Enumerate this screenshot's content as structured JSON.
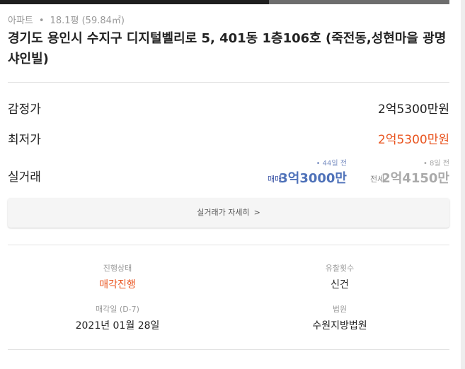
{
  "listing": {
    "property_type": "아파트",
    "separator": "•",
    "area": "18.1평 (59.84㎡)",
    "address": "경기도 용인시 수지구 디지털벨리로 5, 401동 1층106호 (죽전동,성현마을 광명샤인빌)"
  },
  "prices": {
    "appraisal_label": "감정가",
    "appraisal_value": "2억5300만원",
    "minimum_label": "최저가",
    "minimum_value": "2억5300만원",
    "actual_label": "실거래",
    "sale": {
      "days_ago": "• 44일 전",
      "type": "매매",
      "amount": "3억3000만"
    },
    "jeonse": {
      "days_ago": "• 8일 전",
      "type": "전세",
      "amount": "2억4150만"
    }
  },
  "detail_button": {
    "label": "실거래가 자세히",
    "chevron": ">"
  },
  "info": {
    "status_label": "진행상태",
    "status_value": "매각진행",
    "failed_bids_label": "유찰횟수",
    "failed_bids_value": "신건",
    "sale_date_label": "매각일 (D-7)",
    "sale_date_value": "2021년 01월 28일",
    "court_label": "법원",
    "court_value": "수원지방법원"
  },
  "colors": {
    "accent_red": "#e9541f",
    "trade_blue": "#4f72b9",
    "muted_gray": "#9a9a9a"
  }
}
